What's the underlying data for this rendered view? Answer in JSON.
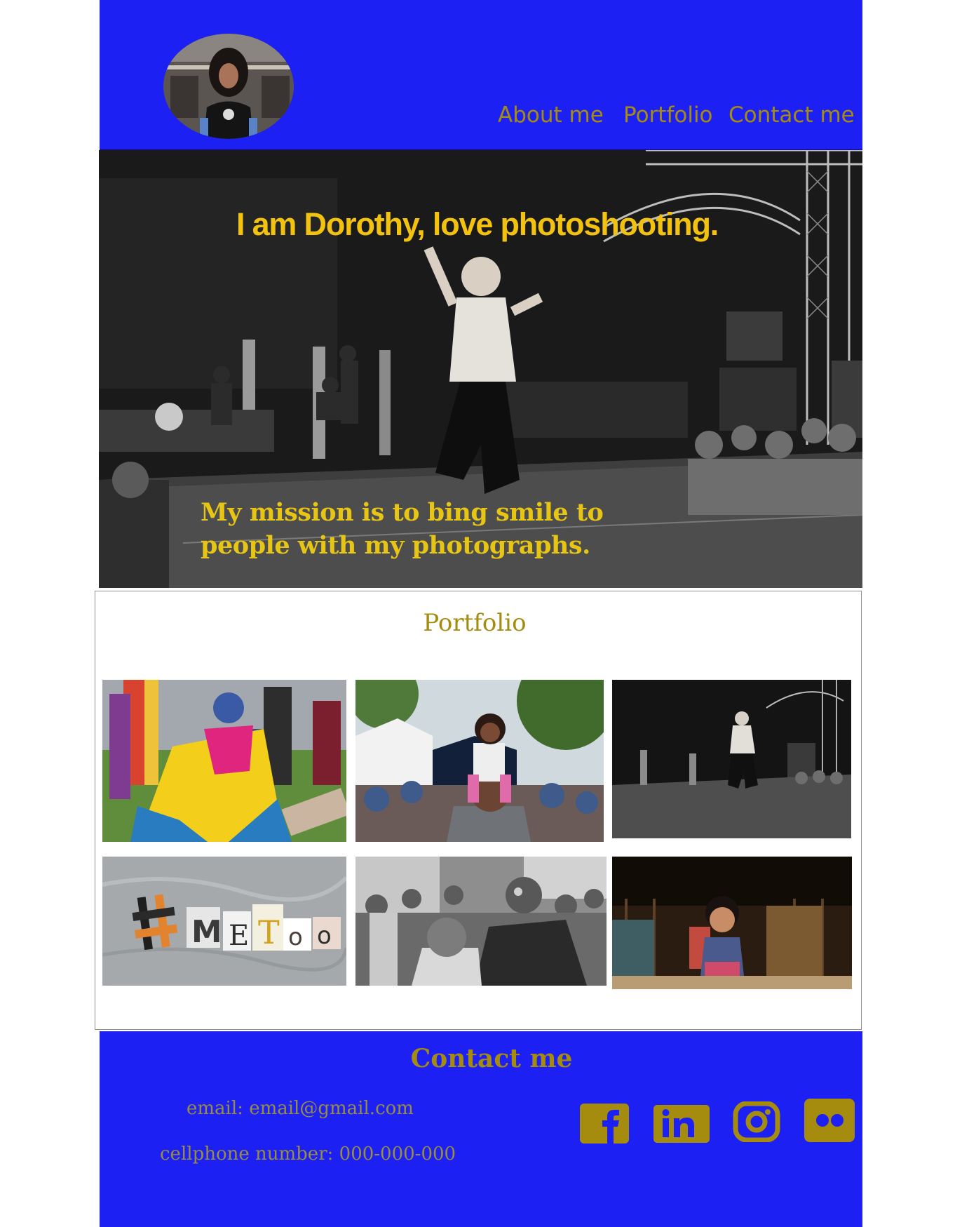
{
  "header": {
    "avatar_alt": "profile photo",
    "nav": [
      "About me",
      "Portfolio",
      "Contact me"
    ]
  },
  "hero": {
    "title": "I am Dorothy, love photoshooting.",
    "mission": "My mission is to bing smile to people with my photographs."
  },
  "portfolio": {
    "title": "Portfolio",
    "photos": [
      "pride-flag-festival",
      "child-on-shoulders",
      "concert-stage",
      "metoo-letters",
      "face-paint-crowd",
      "smiling-child"
    ]
  },
  "contact": {
    "title": "Contact me",
    "email": "email: email@gmail.com",
    "phone": "cellphone number: 000-000-000",
    "social_icons": [
      "facebook-icon",
      "linkedin-icon",
      "instagram-icon",
      "flickr-icon"
    ]
  },
  "colors": {
    "header_blue": "#1d20f3",
    "gold": "#a68c0e",
    "hero_yellow": "#f2c20f"
  }
}
